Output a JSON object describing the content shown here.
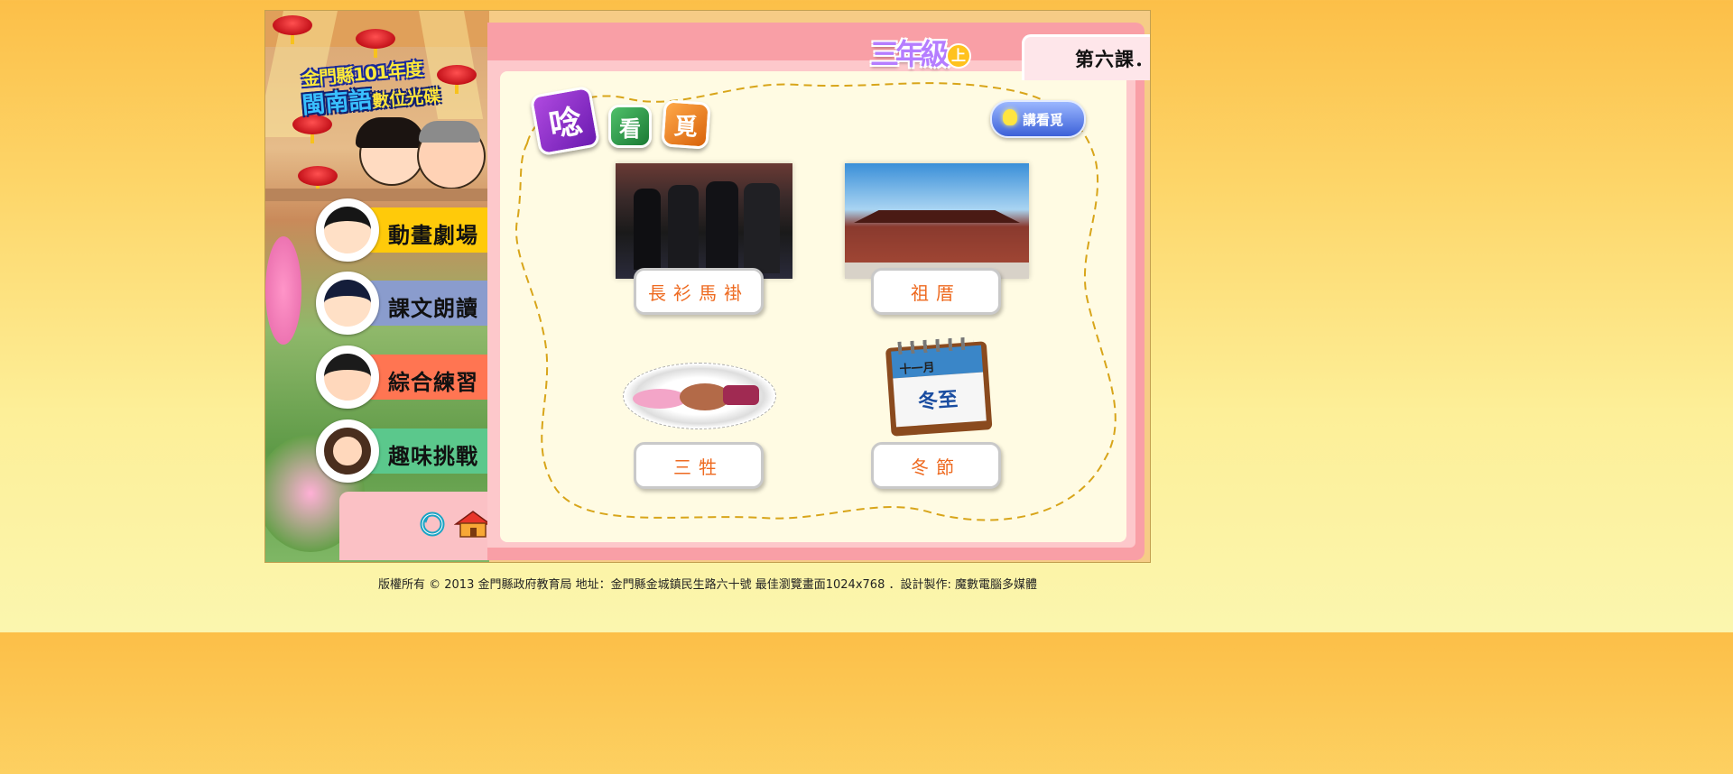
{
  "logo": {
    "line1": "金門縣101年度",
    "line2": "閩南語",
    "line2_small": "數位光碟"
  },
  "grade": {
    "label": "三年級",
    "semester": "上"
  },
  "lesson_title": "第六課．冬節祭祖食頭",
  "section_chars": [
    "唸",
    "看",
    "覓"
  ],
  "hint_button": {
    "label": "講看覓"
  },
  "menu": [
    {
      "label": "動畫劇場",
      "color": "#ffca0a"
    },
    {
      "label": "課文朗讀",
      "color": "#8a9ccd"
    },
    {
      "label": "綜合練習",
      "color": "#ff7552"
    },
    {
      "label": "趣味挑戰",
      "color": "#5bc88c"
    }
  ],
  "words": [
    {
      "label": "長衫馬褂",
      "image": "group-in-robes-photo"
    },
    {
      "label": "祖厝",
      "image": "ancestral-house-photo"
    },
    {
      "label": "三牲",
      "image": "three-offerings-drawing"
    },
    {
      "label": "冬節",
      "image": "winter-solstice-calendar"
    }
  ],
  "calendar": {
    "month": "十一月",
    "day": "冬至"
  },
  "footer": "版權所有 © 2013  金門縣政府教育局  地址：金門縣金城鎮民生路六十號  最佳瀏覽畫面1024x768  ．設計製作: 魔數電腦多媒體"
}
